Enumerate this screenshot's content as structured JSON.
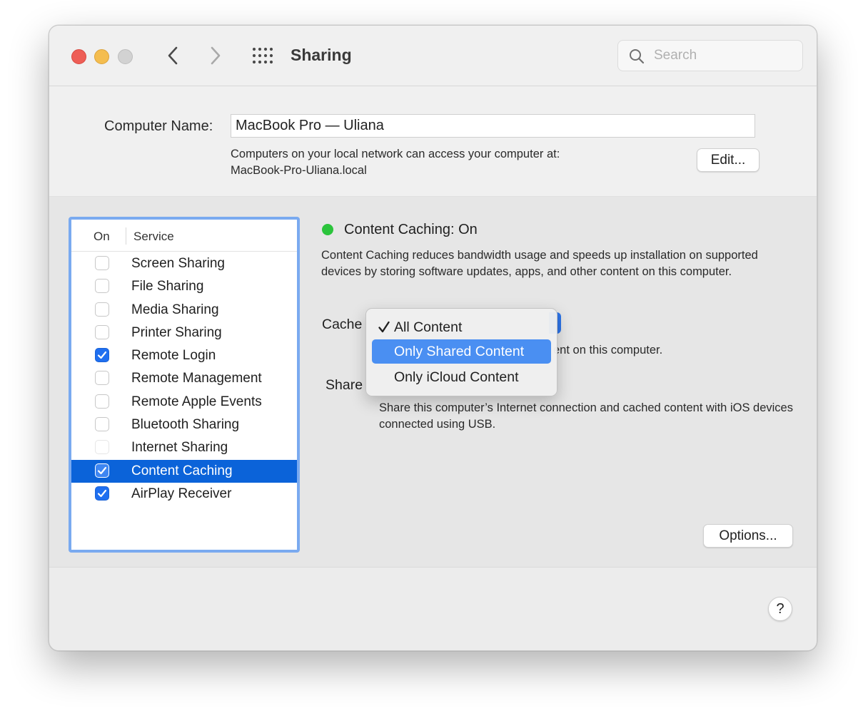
{
  "window": {
    "title": "Sharing"
  },
  "toolbar": {
    "search_placeholder": "Search"
  },
  "computer_name": {
    "label": "Computer Name:",
    "value": "MacBook Pro — Uliana",
    "description_line1": "Computers on your local network can access your computer at:",
    "description_line2": "MacBook-Pro-Uliana.local",
    "edit_label": "Edit..."
  },
  "services": {
    "header_on": "On",
    "header_service": "Service",
    "items": [
      {
        "label": "Screen Sharing",
        "checked": false,
        "selected": false
      },
      {
        "label": "File Sharing",
        "checked": false,
        "selected": false
      },
      {
        "label": "Media Sharing",
        "checked": false,
        "selected": false
      },
      {
        "label": "Printer Sharing",
        "checked": false,
        "selected": false
      },
      {
        "label": "Remote Login",
        "checked": true,
        "selected": false
      },
      {
        "label": "Remote Management",
        "checked": false,
        "selected": false
      },
      {
        "label": "Remote Apple Events",
        "checked": false,
        "selected": false
      },
      {
        "label": "Bluetooth Sharing",
        "checked": false,
        "selected": false
      },
      {
        "label": "Internet Sharing",
        "checked": false,
        "selected": false,
        "disabled": true
      },
      {
        "label": "Content Caching",
        "checked": true,
        "selected": true
      },
      {
        "label": "AirPlay Receiver",
        "checked": true,
        "selected": false
      }
    ]
  },
  "detail": {
    "status_label": "Content Caching: On",
    "status_color": "#2bc43c",
    "description": "Content Caching reduces bandwidth usage and speeds up installation on supported devices by storing software updates, apps, and other content on this computer.",
    "cache_label": "Cache",
    "cache_sub": "ent on this computer.",
    "share_label": "Share",
    "share_desc": "Share this computer’s Internet connection and cached content with iOS devices connected using USB.",
    "options_label": "Options..."
  },
  "cache_menu": {
    "items": [
      {
        "label": "All Content",
        "checked": true,
        "highlighted": false
      },
      {
        "label": "Only Shared Content",
        "checked": false,
        "highlighted": true
      },
      {
        "label": "Only iCloud Content",
        "checked": false,
        "highlighted": false
      }
    ]
  },
  "help": {
    "label": "?"
  },
  "colors": {
    "selection": "#0b63d9",
    "accent": "#1f6ff0",
    "menu_highlight": "#4a8ff2"
  }
}
